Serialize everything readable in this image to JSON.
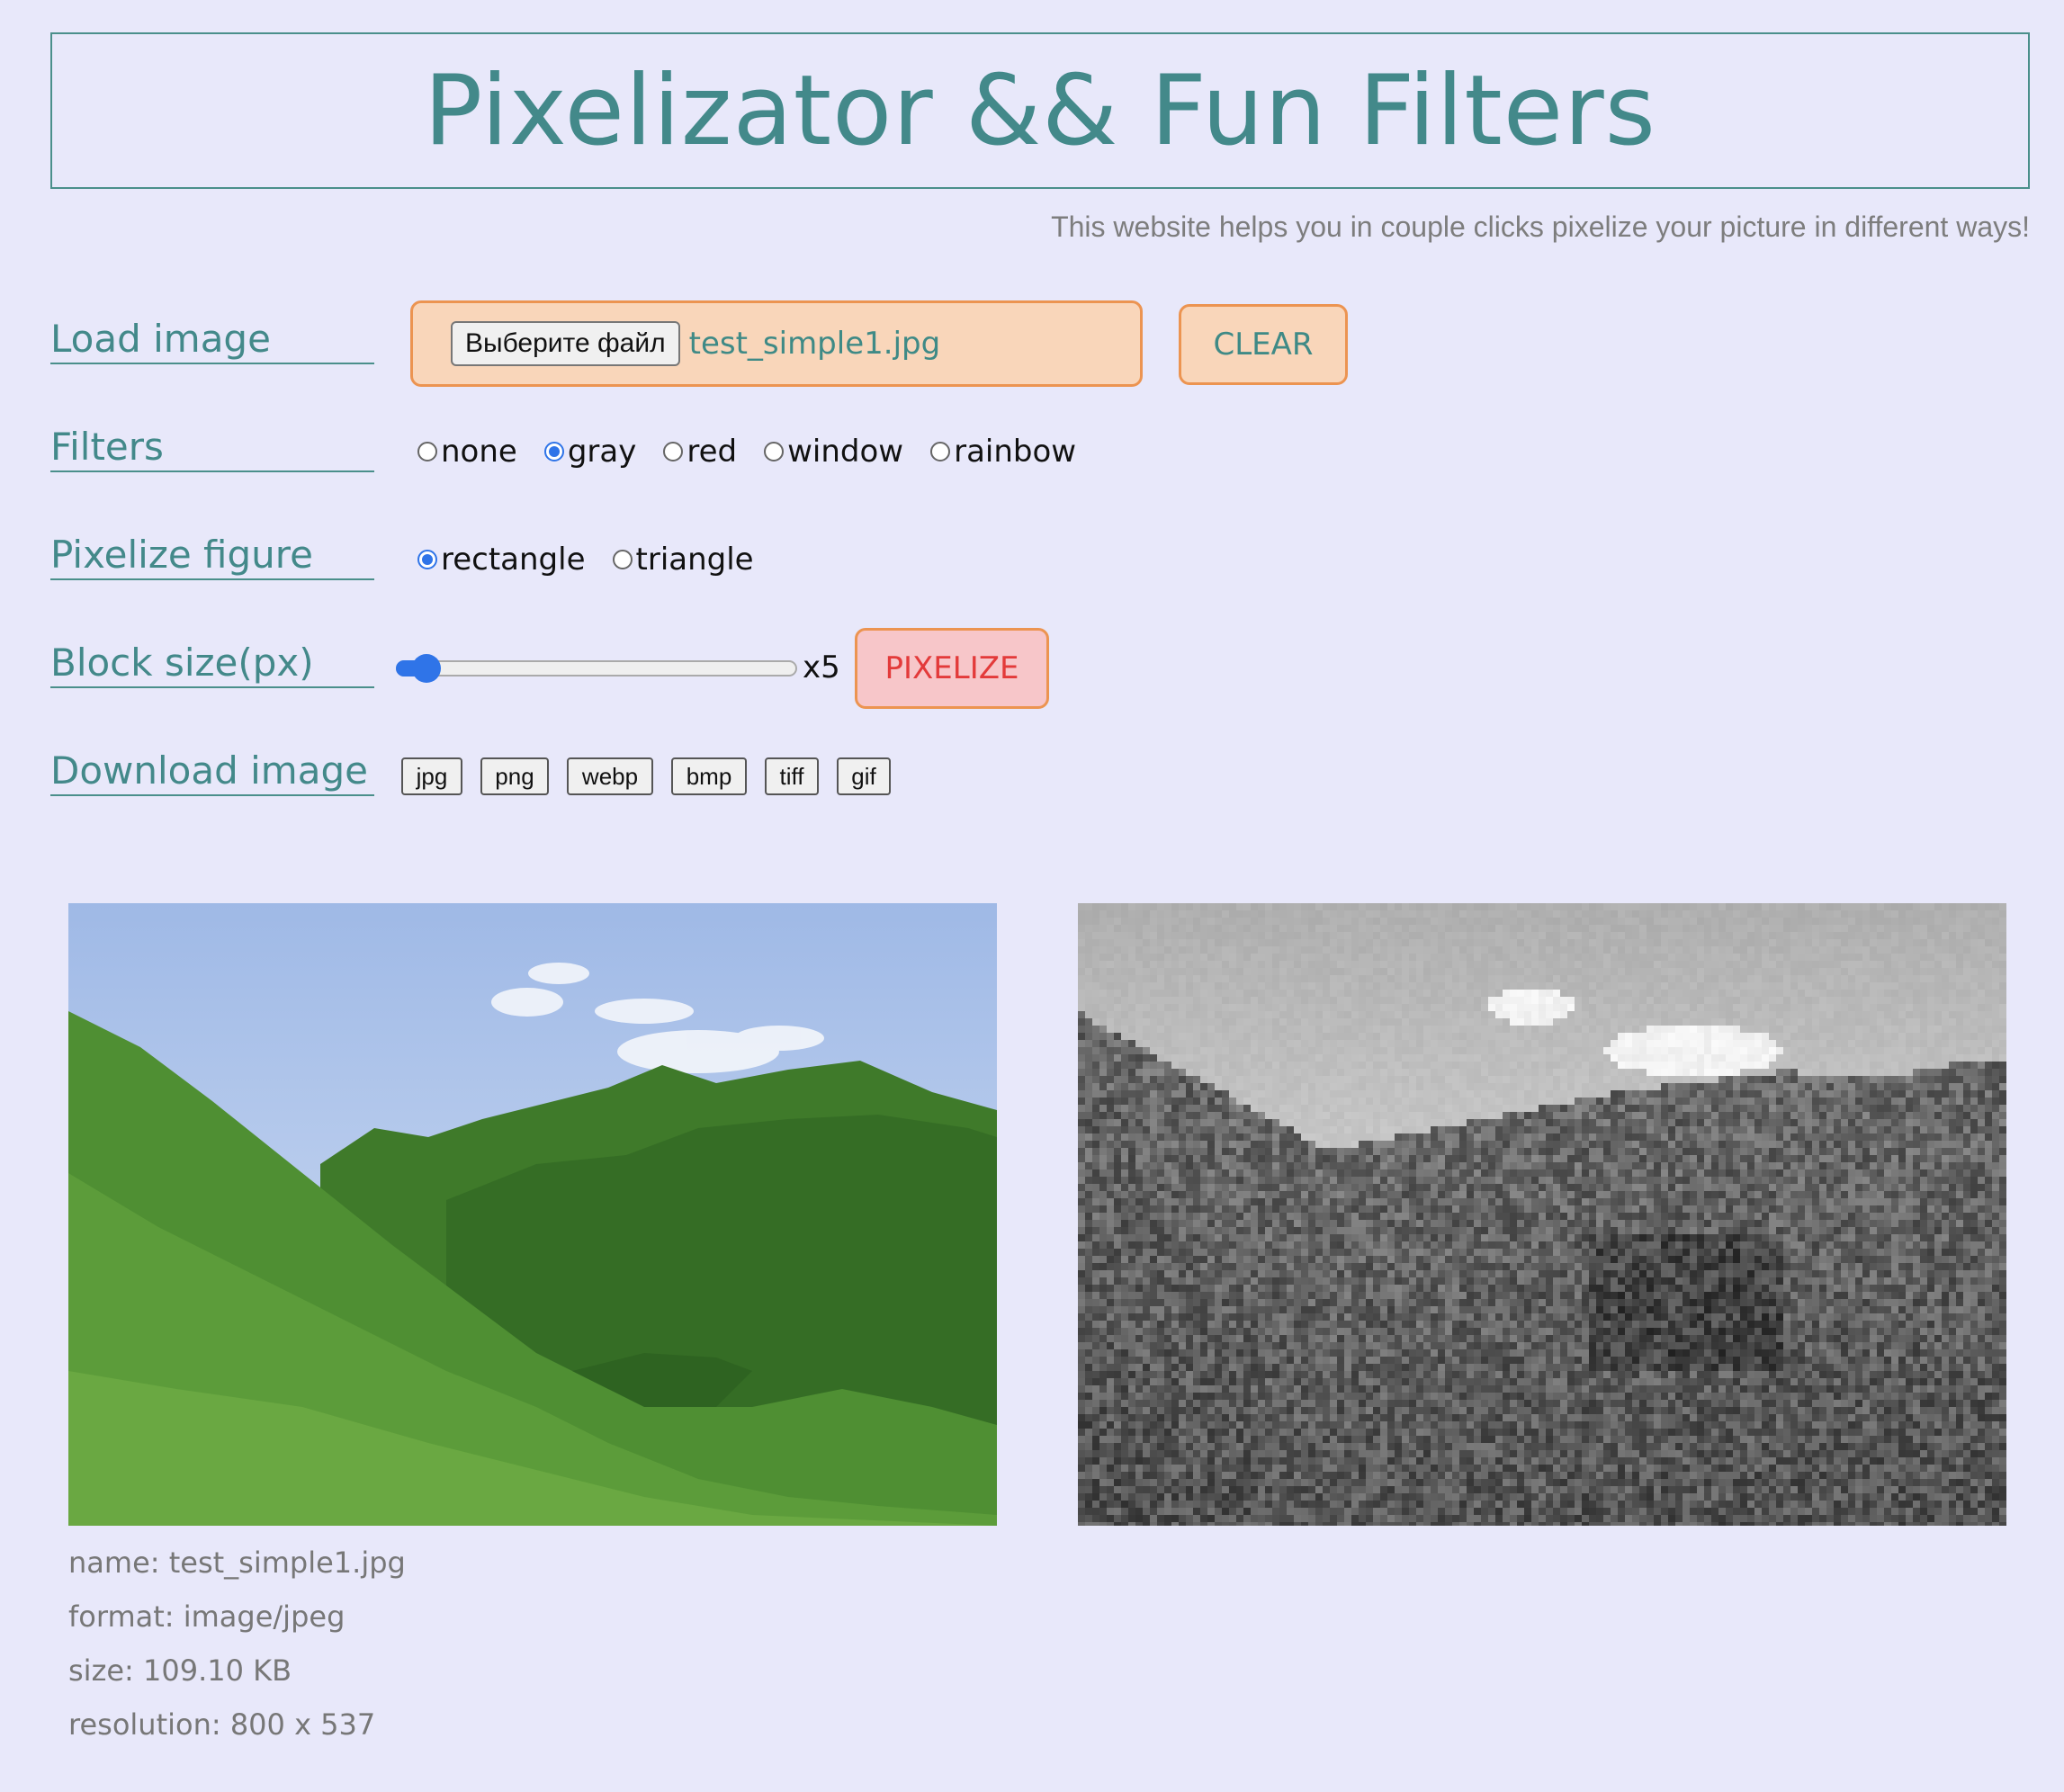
{
  "header": {
    "title": "Pixelizator && Fun Filters",
    "subtitle": "This website helps you in couple clicks pixelize your picture in different ways!"
  },
  "load": {
    "label": "Load image",
    "choose_button": "Выберите файл",
    "file_name": "test_simple1.jpg",
    "clear_button": "CLEAR"
  },
  "filters": {
    "label": "Filters",
    "options": [
      "none",
      "gray",
      "red",
      "window",
      "rainbow"
    ],
    "selected": "gray"
  },
  "figure": {
    "label": "Pixelize figure",
    "options": [
      "rectangle",
      "triangle"
    ],
    "selected": "rectangle"
  },
  "block": {
    "label": "Block size(px)",
    "value_text": "x5",
    "slider_fraction": 0.05,
    "pixelize_button": "PIXELIZE"
  },
  "download": {
    "label": "Download image",
    "formats": [
      "jpg",
      "png",
      "webp",
      "bmp",
      "tiff",
      "gif"
    ]
  },
  "image_info": {
    "name": "name: test_simple1.jpg",
    "format": "format: image/jpeg",
    "size": "size: 109.10 KB",
    "resolution": "resolution: 800 x 537"
  },
  "colors": {
    "accent": "#43898a",
    "orange_border": "#ec9451",
    "pixelize_text": "#e33a3a",
    "radio_checked": "#2f74e8"
  }
}
